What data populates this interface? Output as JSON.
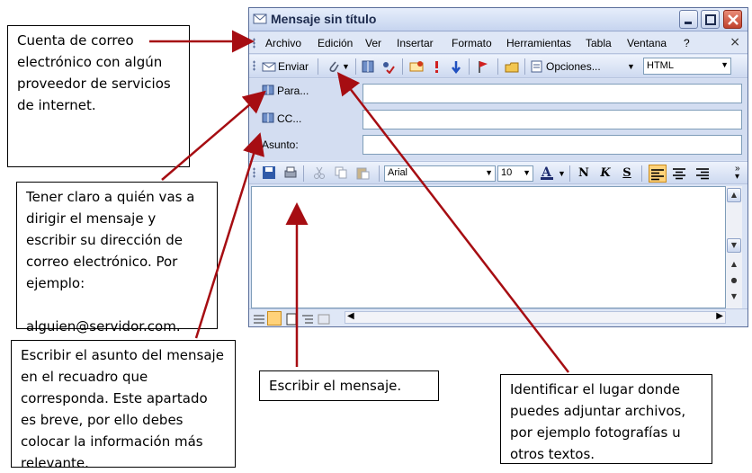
{
  "window": {
    "title": "Mensaje sin título",
    "menu": [
      "Archivo",
      "Edición",
      "Ver",
      "Insertar",
      "Formato",
      "Herramientas",
      "Tabla",
      "Ventana",
      "?"
    ],
    "menu_close": "×",
    "toolbar": {
      "send_label": "Enviar",
      "options_label": "Opciones...",
      "format_value": "HTML"
    },
    "fields": {
      "to_label": "Para...",
      "cc_label": "CC...",
      "subject_label": "Asunto:"
    },
    "format_toolbar": {
      "font_value": "Arial",
      "size_value": "10",
      "bold": "N",
      "italic": "K",
      "underline": "S"
    }
  },
  "notes": {
    "account": "Cuenta de correo electrónico con algún proveedor de servicios de internet.",
    "recipient": "Tener claro a quién vas a dirigir el mensaje y escribir su dirección de correo electrónico. Por ejemplo:\n\nalguien@servidor.com.",
    "subject": "Escribir el asunto del mensaje en el recuadro que corresponda. Este apartado es breve, por ello debes colocar la información más relevante.",
    "message": "Escribir el mensaje.",
    "attach": "Identificar el lugar donde puedes adjuntar archivos, por ejemplo fotografías u otros textos."
  },
  "colors": {
    "arrow": "#a60d12",
    "window_frame": "#5a6e9a",
    "active_button": "#ffd27a"
  },
  "icons": [
    "envelope-icon",
    "paperclip-icon",
    "address-book-icon",
    "check-names-icon",
    "flag-icon",
    "minimize-icon",
    "maximize-icon",
    "close-icon",
    "save-icon",
    "print-icon",
    "cut-icon",
    "copy-icon",
    "paste-icon",
    "font-color-icon",
    "align-left-icon",
    "align-center-icon",
    "align-right-icon"
  ]
}
